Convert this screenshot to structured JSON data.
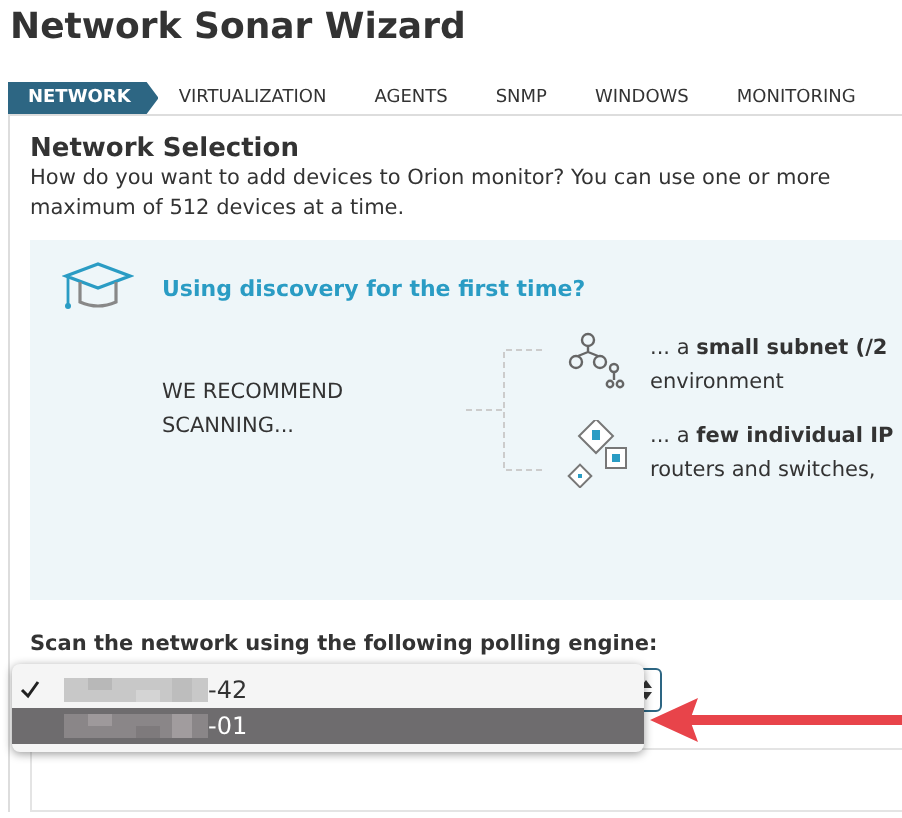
{
  "title": "Network Sonar Wizard",
  "steps": [
    {
      "label": "NETWORK",
      "selected": true
    },
    {
      "label": "VIRTUALIZATION",
      "selected": false
    },
    {
      "label": "AGENTS",
      "selected": false
    },
    {
      "label": "SNMP",
      "selected": false
    },
    {
      "label": "WINDOWS",
      "selected": false
    },
    {
      "label": "MONITORING",
      "selected": false
    }
  ],
  "section": {
    "heading": "Network Selection",
    "description_lines": [
      "How do you want to add devices to Orion monitor? You can use one or more",
      "maximum of 512 devices at a time."
    ]
  },
  "tip": {
    "heading": "Using discovery for the first time?",
    "recommend": "WE RECOMMEND SCANNING...",
    "options": [
      {
        "kind": "subnet",
        "line1": "... a **small subnet (/2**",
        "line2": "environment"
      },
      {
        "kind": "ip",
        "line1": "... a **few individual IP**",
        "line2": "routers and switches,"
      }
    ]
  },
  "engine": {
    "label": "Scan the network using the following polling engine:",
    "options": [
      {
        "suffix": "-42",
        "checked": true,
        "selected": false
      },
      {
        "suffix": "-01",
        "checked": false,
        "selected": true
      }
    ]
  }
}
